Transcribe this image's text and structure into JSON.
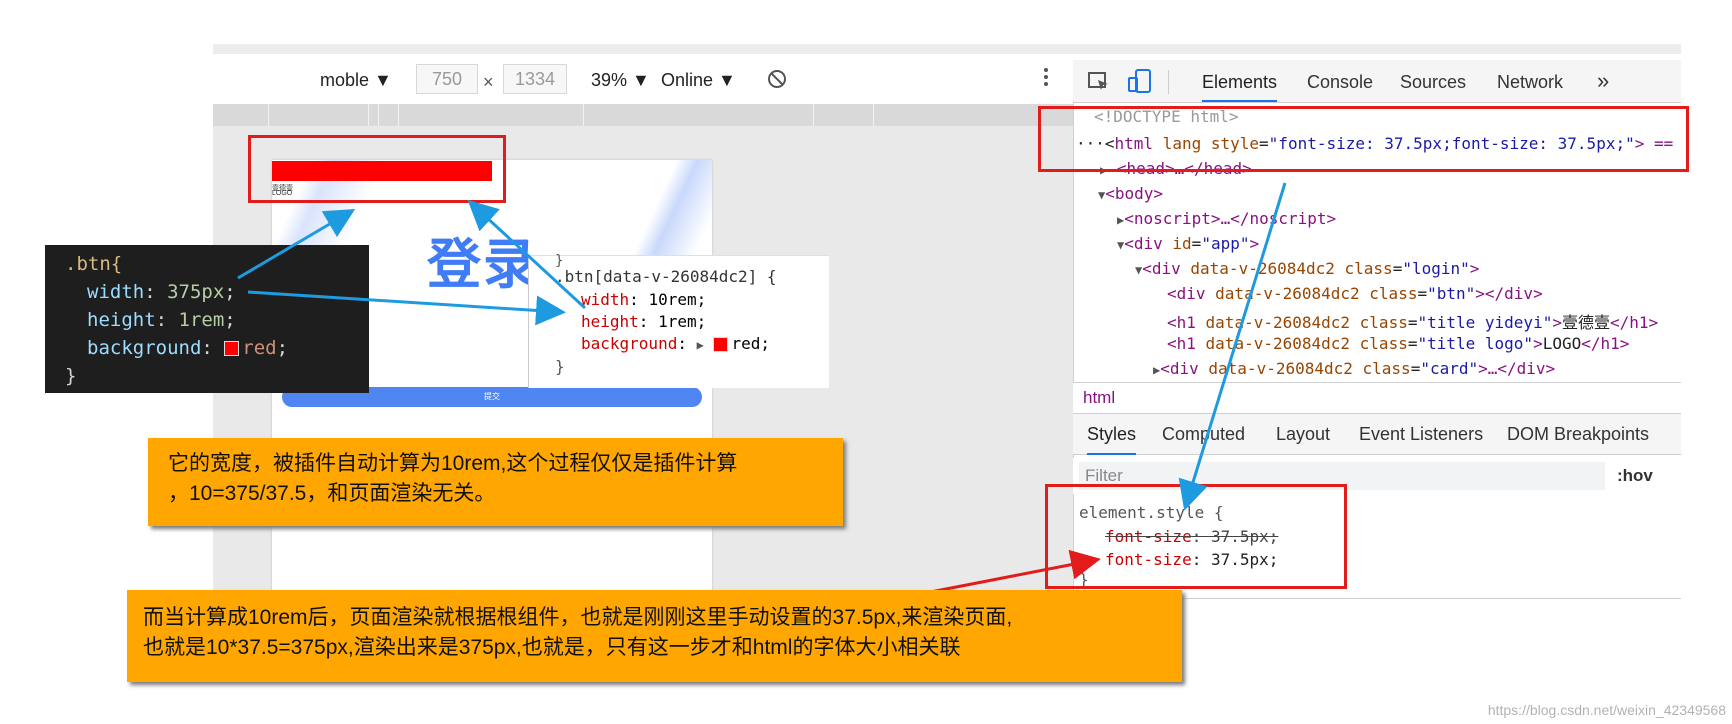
{
  "device_toolbar": {
    "device": "moble ▼",
    "width": "750",
    "times": "×",
    "height": "1334",
    "zoom": "39% ▼",
    "network": "Online ▼"
  },
  "phone": {
    "tiny_line_1": "壹德壹",
    "tiny_line_2": "LOGO",
    "login_title": "登录",
    "submit_label": "提交"
  },
  "devtools": {
    "tabs": [
      "Elements",
      "Console",
      "Sources",
      "Network"
    ],
    "more": "»",
    "dom": {
      "doctype": "<!DOCTYPE html>",
      "html_prefix": "···<",
      "html_tag": "html",
      "html_attr": " lang style",
      "html_eq": "=",
      "html_val": "\"font-size: 37.5px;font-size: 37.5px;\"",
      "html_close": "> ==",
      "head": "<head>…</head>",
      "body": "<body>",
      "noscript": "<noscript>…</noscript>",
      "div_app_tag": "<div",
      "div_app_attr": " id",
      "div_app_val": "\"app\"",
      "div_app_close": ">",
      "login_open": "<div",
      "login_attr": " data-v-26084dc2 class",
      "login_val": "\"login\"",
      "login_close": ">",
      "btn_open": "<div",
      "btn_attr": " data-v-26084dc2 class",
      "btn_val": "\"btn\"",
      "btn_close": "></div>",
      "h1a_open": "<h1",
      "h1a_attr": " data-v-26084dc2 class",
      "h1a_val": "\"title yideyi\"",
      "h1a_gt": ">",
      "h1a_text": "壹德壹",
      "h1a_close": "</h1>",
      "h1b_open": "<h1",
      "h1b_attr": " data-v-26084dc2 class",
      "h1b_val": "\"title logo\"",
      "h1b_gt": ">",
      "h1b_text": "LOGO",
      "h1b_close": "</h1>",
      "card_open": "<div",
      "card_attr": " data-v-26084dc2 class",
      "card_val": "\"card\"",
      "card_close": ">…</div>"
    },
    "breadcrumb": "html",
    "style_tabs": [
      "Styles",
      "Computed",
      "Layout",
      "Event Listeners",
      "DOM Breakpoints"
    ],
    "filter_placeholder": "Filter",
    "hov": ":hov",
    "element_style": "element.style {",
    "rule1_prop": "font-size",
    "rule1_val": ": 37.5px;",
    "rule2_prop": "font-size",
    "rule2_val": ": 37.5px;",
    "rule_close": "}"
  },
  "code_dark": {
    "selector": ".btn{",
    "width_key": "width",
    "width_val": "375px",
    "height_key": "height",
    "height_val": "1rem",
    "bg_key": "background",
    "bg_val": "red",
    "close": "}"
  },
  "code_light": {
    "top": "}",
    "selector": ".btn[data-v-26084dc2] {",
    "width_key": "width",
    "width_val": ": 10rem;",
    "height_key": "height",
    "height_val": ": 1rem;",
    "bg_key": "background",
    "bg_val": "red;",
    "close": "}"
  },
  "notes": {
    "note1_line1": "它的宽度，被插件自动计算为10rem,这个过程仅仅是插件计算",
    "note1_line2": "，10=375/37.5，和页面渲染无关。",
    "note2_line1": "而当计算成10rem后，页面渲染就根据根组件，也就是刚刚这里手动设置的37.5px,来渲染页面,",
    "note2_line2": "也就是10*37.5=375px,渲染出来是375px,也就是，只有这一步才和html的字体大小相关联"
  },
  "watermark": "https://blog.csdn.net/weixin_42349568",
  "colors": {
    "annotation_red": "#e21b1b",
    "arrow_blue": "#1e9be0",
    "note_orange": "#ffa600",
    "button_blue": "#4f86f1",
    "title_blue": "#3f7cf5"
  }
}
